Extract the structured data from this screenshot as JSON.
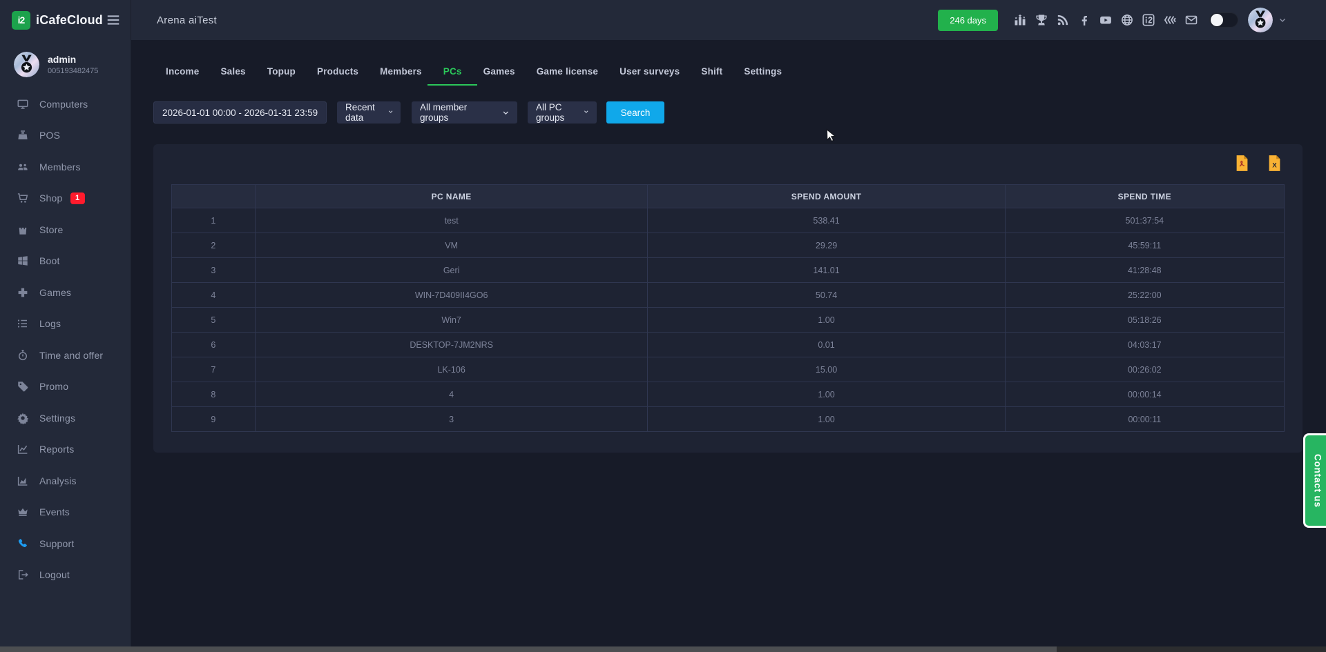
{
  "topbar": {
    "brand": "iCafeCloud",
    "brand_mark": "i2",
    "title": "Arena aiTest",
    "days_badge": "246 days",
    "icons": [
      {
        "name": "ranking",
        "icon": "ranking"
      },
      {
        "name": "trophy",
        "icon": "trophy"
      },
      {
        "name": "rss",
        "icon": "rss"
      },
      {
        "name": "facebook",
        "icon": "facebook"
      },
      {
        "name": "youtube",
        "icon": "youtube"
      },
      {
        "name": "website-globe",
        "icon": "globe"
      },
      {
        "name": "icafecloud",
        "icon": "icafe"
      },
      {
        "name": "layers",
        "icon": "layers"
      },
      {
        "name": "mail",
        "icon": "mail"
      }
    ]
  },
  "user": {
    "name": "admin",
    "id": "005193482475"
  },
  "sidebar": {
    "items": [
      {
        "label": "Computers",
        "icon": "computers"
      },
      {
        "label": "POS",
        "icon": "pos"
      },
      {
        "label": "Members",
        "icon": "members"
      },
      {
        "label": "Shop",
        "icon": "shop",
        "badge": "1"
      },
      {
        "label": "Store",
        "icon": "store"
      },
      {
        "label": "Boot",
        "icon": "boot"
      },
      {
        "label": "Games",
        "icon": "games"
      },
      {
        "label": "Logs",
        "icon": "logs"
      },
      {
        "label": "Time and offer",
        "icon": "time"
      },
      {
        "label": "Promo",
        "icon": "promo"
      },
      {
        "label": "Settings",
        "icon": "settings"
      },
      {
        "label": "Reports",
        "icon": "reports"
      },
      {
        "label": "Analysis",
        "icon": "analysis"
      },
      {
        "label": "Events",
        "icon": "events"
      },
      {
        "label": "Support",
        "icon": "support",
        "accent": true
      },
      {
        "label": "Logout",
        "icon": "logout"
      }
    ]
  },
  "tabs": [
    {
      "label": "Income"
    },
    {
      "label": "Sales"
    },
    {
      "label": "Topup"
    },
    {
      "label": "Products"
    },
    {
      "label": "Members"
    },
    {
      "label": "PCs",
      "active": true
    },
    {
      "label": "Games"
    },
    {
      "label": "Game license"
    },
    {
      "label": "User surveys"
    },
    {
      "label": "Shift"
    },
    {
      "label": "Settings"
    }
  ],
  "filters": {
    "date_range": "2026-01-01 00:00 - 2026-01-31 23:59",
    "recent_data": "Recent data",
    "member_groups": "All member groups",
    "pc_groups": "All PC groups",
    "search_label": "Search"
  },
  "export": {
    "pdf": "export-pdf",
    "excel": "export-excel"
  },
  "table": {
    "columns": [
      "",
      "PC NAME",
      "SPEND AMOUNT",
      "SPEND TIME"
    ],
    "rows": [
      [
        "1",
        "test",
        "538.41",
        "501:37:54"
      ],
      [
        "2",
        "VM",
        "29.29",
        "45:59:11"
      ],
      [
        "3",
        "Geri",
        "141.01",
        "41:28:48"
      ],
      [
        "4",
        "WIN-7D409II4GO6",
        "50.74",
        "25:22:00"
      ],
      [
        "5",
        "Win7",
        "1.00",
        "05:18:26"
      ],
      [
        "6",
        "DESKTOP-7JM2NRS",
        "0.01",
        "04:03:17"
      ],
      [
        "7",
        "LK-106",
        "15.00",
        "00:26:02"
      ],
      [
        "8",
        "4",
        "1.00",
        "00:00:14"
      ],
      [
        "9",
        "3",
        "1.00",
        "00:00:11"
      ]
    ]
  },
  "contact": {
    "label": "Contact us"
  },
  "colors": {
    "topbar_bg": "#232939",
    "main_bg": "#171b28",
    "panel_bg": "#1e2333",
    "accent_green": "#22b14c",
    "tab_active_green": "#2bc85a",
    "search_blue": "#10a8ea",
    "badge_red": "#ff1b2d",
    "contact_green": "#27b561",
    "support_blue": "#1d9bf0",
    "export_icon_orange": "#f9b234"
  }
}
